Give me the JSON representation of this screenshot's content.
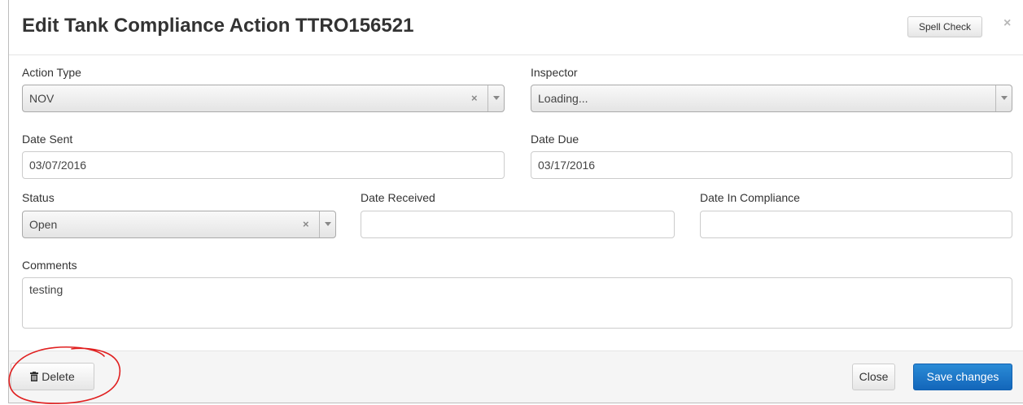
{
  "modal": {
    "title": "Edit Tank Compliance Action TTRO156521",
    "spell_check_label": "Spell Check",
    "close_symbol": "×"
  },
  "form": {
    "action_type": {
      "label": "Action Type",
      "value": "NOV"
    },
    "inspector": {
      "label": "Inspector",
      "value": "Loading..."
    },
    "date_sent": {
      "label": "Date Sent",
      "value": "03/07/2016"
    },
    "date_due": {
      "label": "Date Due",
      "value": "03/17/2016"
    },
    "status": {
      "label": "Status",
      "value": "Open"
    },
    "date_received": {
      "label": "Date Received",
      "value": ""
    },
    "date_in_compliance": {
      "label": "Date In Compliance",
      "value": ""
    },
    "comments": {
      "label": "Comments",
      "value": "testing"
    }
  },
  "footer": {
    "delete_label": "Delete",
    "close_label": "Close",
    "save_label": "Save changes"
  },
  "icons": {
    "trash": "trash-icon",
    "clear": "×"
  },
  "colors": {
    "primary": "#1a74c6",
    "annotation": "#e02020"
  }
}
